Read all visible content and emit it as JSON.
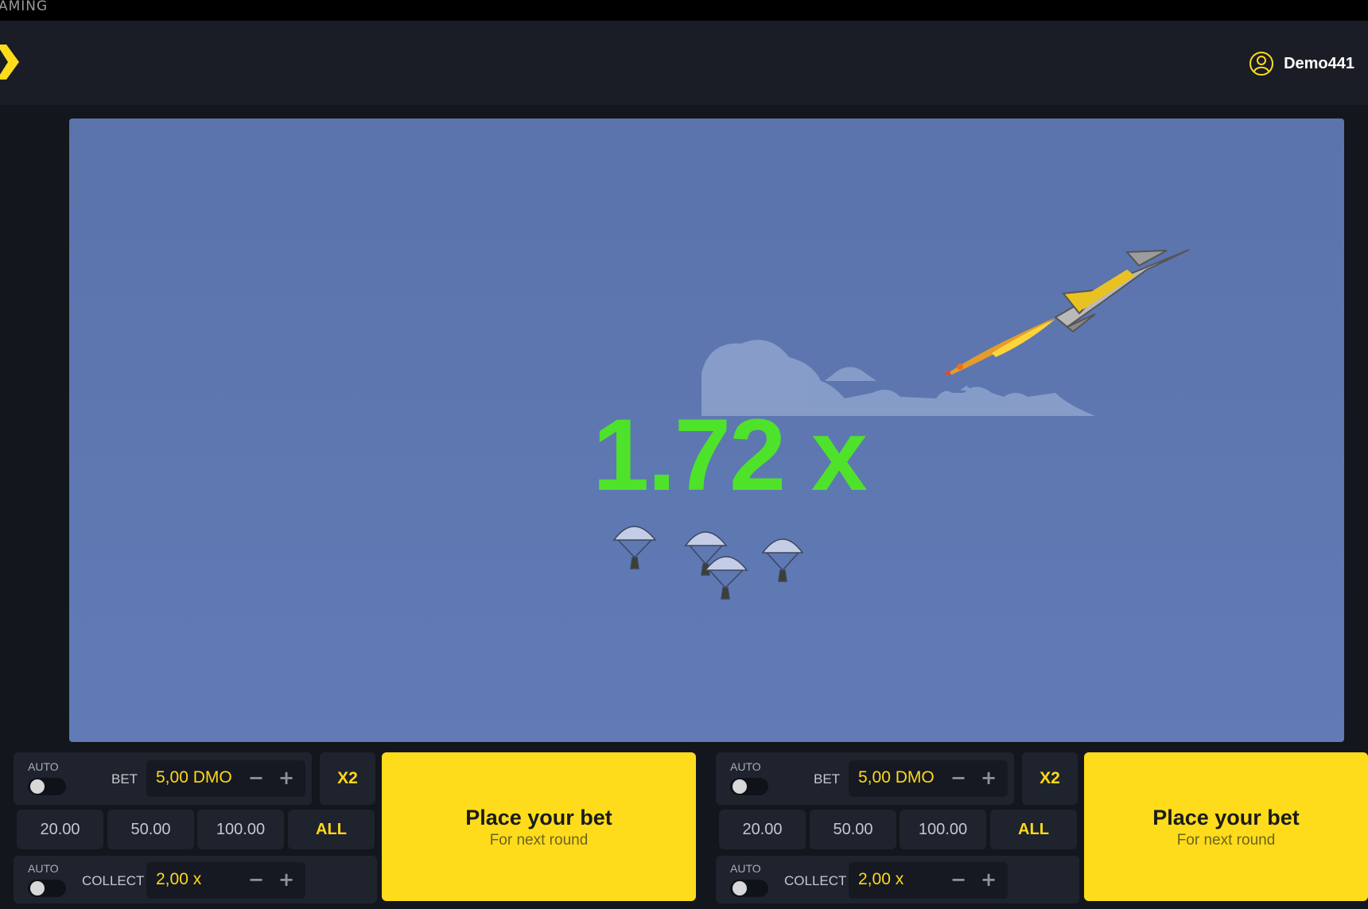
{
  "header": {
    "brand_fragment": "AMING",
    "username": "Demo441"
  },
  "game": {
    "multiplier": "1.72 x"
  },
  "panels": [
    {
      "auto_bet_label": "AUTO",
      "bet_label": "BET",
      "bet_value": "5,00 DMO",
      "double_label": "X2",
      "quick_amounts": [
        "20.00",
        "50.00",
        "100.00",
        "ALL"
      ],
      "auto_collect_label": "AUTO",
      "collect_label": "COLLECT",
      "collect_value": "2,00 x",
      "place_title": "Place your bet",
      "place_sub": "For next round"
    },
    {
      "auto_bet_label": "AUTO",
      "bet_label": "BET",
      "bet_value": "5,00 DMO",
      "double_label": "X2",
      "quick_amounts": [
        "20.00",
        "50.00",
        "100.00",
        "ALL"
      ],
      "auto_collect_label": "AUTO",
      "collect_label": "COLLECT",
      "collect_value": "2,00 x",
      "place_title": "Place your bet",
      "place_sub": "For next round"
    }
  ],
  "colors": {
    "accent": "#fedc1b",
    "multiplier": "#4ee22b",
    "sky": "#5f79b3"
  }
}
